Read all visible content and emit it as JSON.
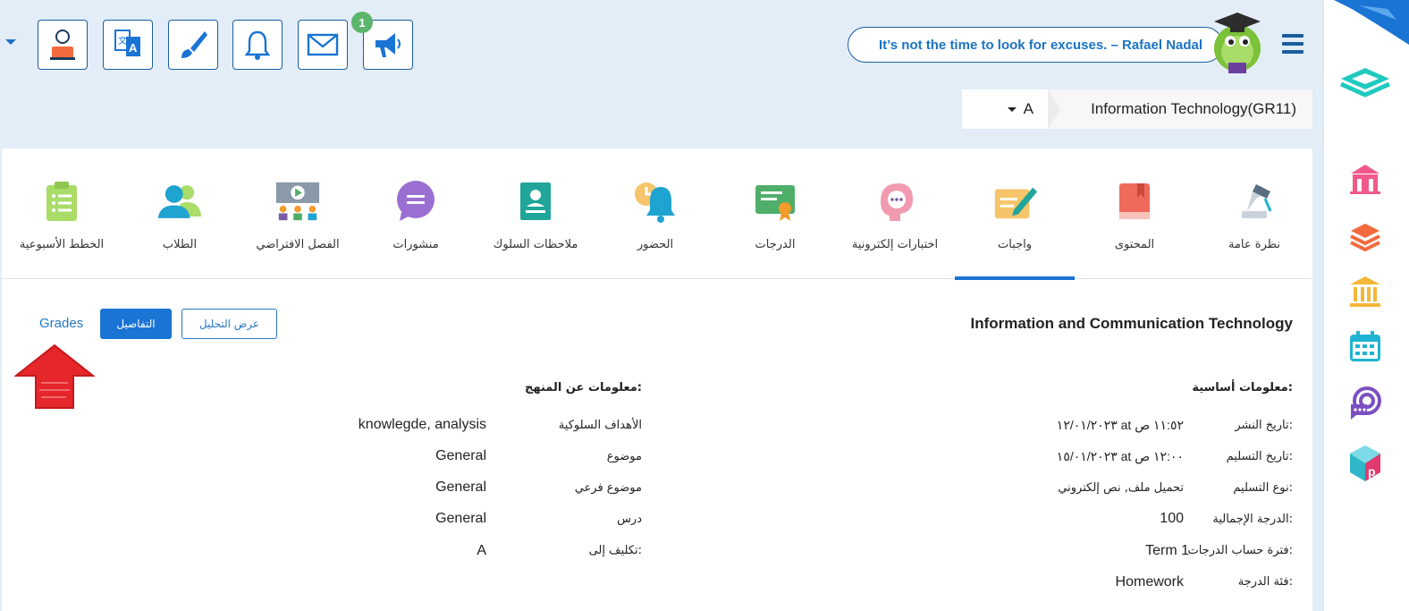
{
  "header": {
    "notification_count": "1",
    "quote": "It’s not the time to look for excuses. – Rafael Nadal",
    "section_value": "A",
    "course_title": "Information Technology(GR11)",
    "tools": [
      {
        "name": "announcement-icon"
      },
      {
        "name": "mail-icon"
      },
      {
        "name": "bell-icon"
      },
      {
        "name": "brush-icon"
      },
      {
        "name": "translate-icon"
      },
      {
        "name": "user-profile-icon"
      }
    ]
  },
  "tabs": [
    {
      "label": "نظرة عامة",
      "icon": "overview-icon"
    },
    {
      "label": "المحتوى",
      "icon": "content-book-icon"
    },
    {
      "label": "واجبات",
      "icon": "assignment-icon",
      "active": true
    },
    {
      "label": "اختبارات إلكترونية",
      "icon": "online-test-icon"
    },
    {
      "label": "الدرجات",
      "icon": "grades-certificate-icon"
    },
    {
      "label": "الحضور",
      "icon": "attendance-clock-icon"
    },
    {
      "label": "ملاحظات السلوك",
      "icon": "behavior-notes-icon"
    },
    {
      "label": "منشورات",
      "icon": "posts-chat-icon"
    },
    {
      "label": "الفصل الافتراضي",
      "icon": "virtual-class-icon"
    },
    {
      "label": "الطلاب",
      "icon": "students-icon"
    },
    {
      "label": "الخطط الأسبوعية",
      "icon": "weekly-plan-icon"
    }
  ],
  "detail": {
    "title": "Information and Communication Technology",
    "btn_analysis": "عرض التحليل",
    "btn_details": "التفاصيل",
    "btn_grades": "Grades"
  },
  "basic_info": {
    "heading": "معلومات أساسية:",
    "rows": [
      {
        "label": "تاريخ النشر:",
        "value": "١٢/٠١/٢٠٢٣ at ١١:٥٢ ص"
      },
      {
        "label": "تاريخ التسليم:",
        "value": "١٥/٠١/٢٠٢٣ at ١٢:٠٠ ص"
      },
      {
        "label": "نوع التسليم:",
        "value": "تحميل ملف, نص إلكتروني"
      },
      {
        "label": "الدرجة الإجمالية:",
        "value": "100"
      },
      {
        "label": "فترة حساب الدرجات:",
        "value": "Term 1"
      },
      {
        "label": "فئة الدرجة:",
        "value": "Homework"
      }
    ]
  },
  "curriculum_info": {
    "heading": "معلومات عن المنهج:",
    "rows": [
      {
        "label": "الأهداف السلوكية",
        "value": "knowlegde, analysis"
      },
      {
        "label": "موضوع",
        "value": "General"
      },
      {
        "label": "موضوع فرعي",
        "value": "General"
      },
      {
        "label": "درس",
        "value": "General"
      },
      {
        "label": "تكليف إلى:",
        "value": "A"
      }
    ]
  },
  "colors": {
    "primary": "#1a74d4",
    "page_bg": "#e3edf8",
    "badge": "#5bb56b",
    "arrow": "#e5262a"
  }
}
